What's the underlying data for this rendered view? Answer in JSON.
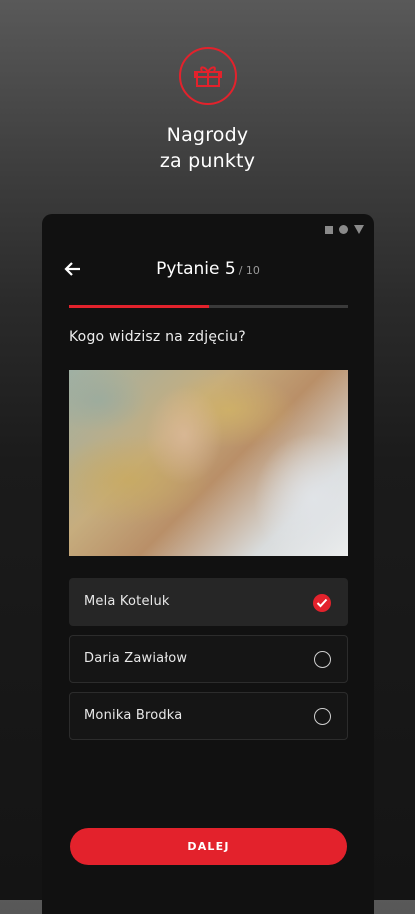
{
  "promo": {
    "icon": "gift-icon",
    "title_line1": "Nagrody",
    "title_line2": "za punkty"
  },
  "screen": {
    "status_icons": [
      "square-icon",
      "circle-icon",
      "triangle-down-icon"
    ],
    "header": {
      "back_icon": "arrow-left-icon",
      "title": "Pytanie 5",
      "total": "/ 10"
    },
    "progress": {
      "current": 5,
      "total": 10,
      "fraction": 0.5
    },
    "question": "Kogo widzisz na zdjęciu?",
    "photo": {
      "type": "photo",
      "subject": "portrait"
    },
    "options": [
      {
        "label": "Mela Koteluk",
        "selected": true
      },
      {
        "label": "Daria Zawiałow",
        "selected": false
      },
      {
        "label": "Monika Brodka",
        "selected": false
      }
    ],
    "next_button": "DALEJ"
  },
  "colors": {
    "accent": "#e3222c",
    "background": "#111111",
    "selected_option": "#262626"
  }
}
